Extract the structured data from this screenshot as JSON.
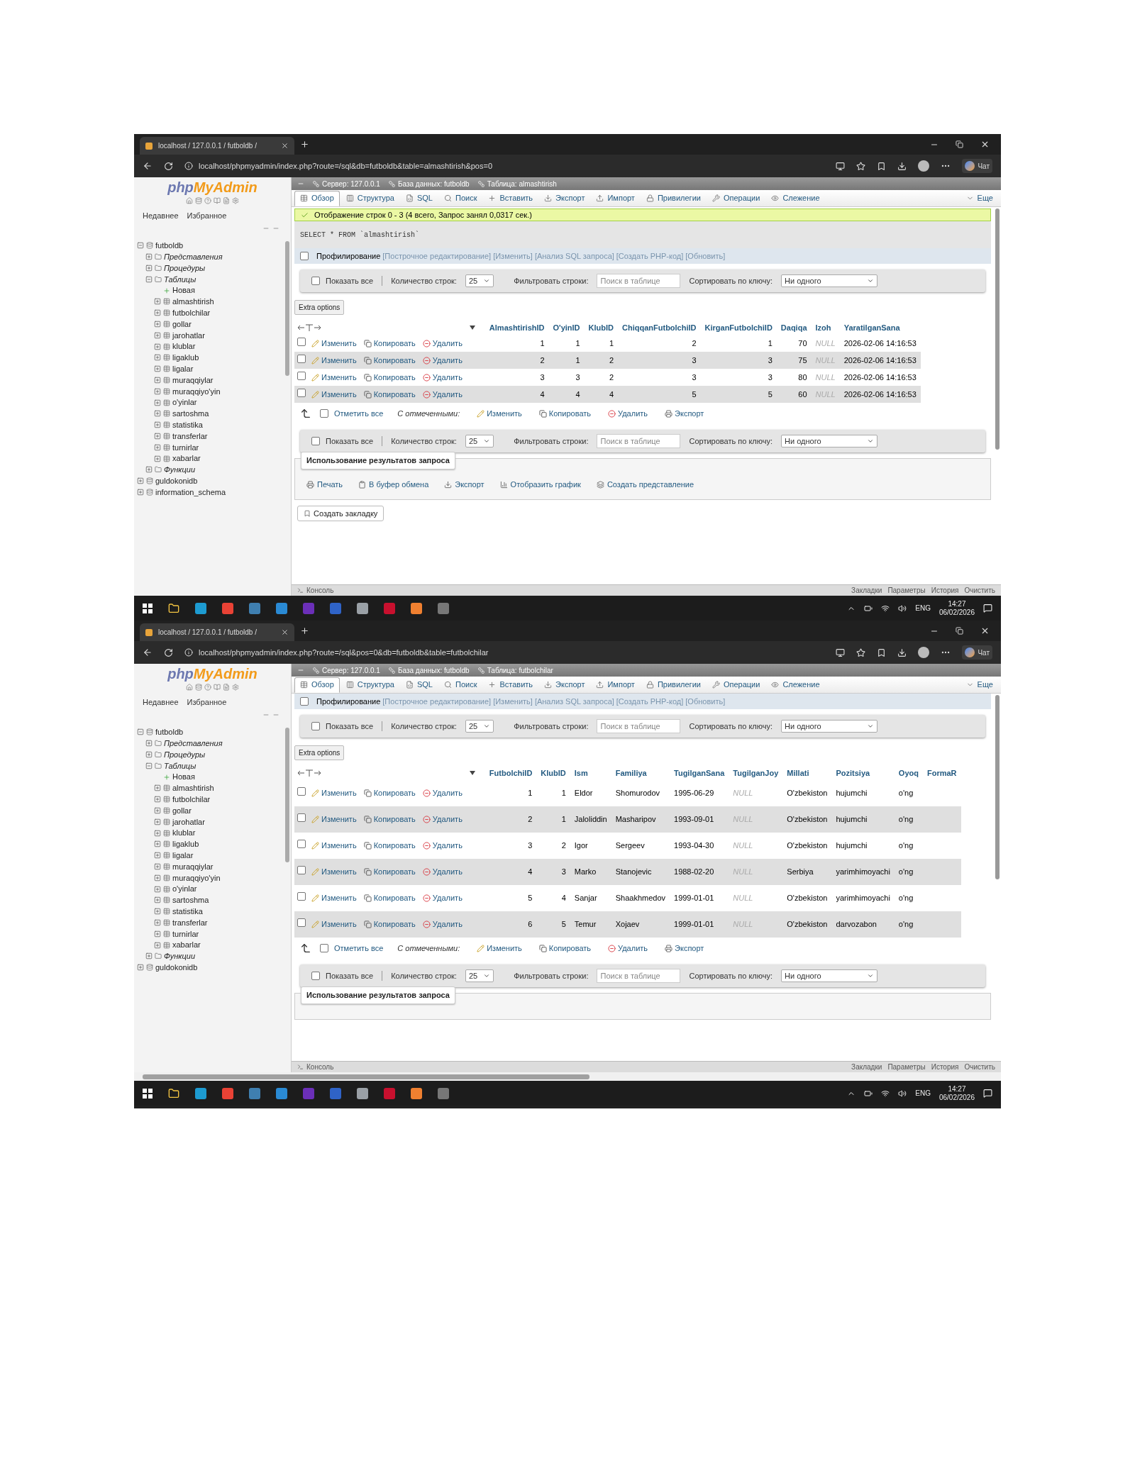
{
  "screens": [
    {
      "browser_tab": "localhost / 127.0.0.1 / futboldb /",
      "url": "localhost/phpmyadmin/index.php?route=/sql&db=futboldb&table=almashtirish&pos=0",
      "chat_button": "Чат",
      "logo": {
        "php": "php",
        "myadmin": "MyAdmin"
      },
      "sidebar_tabs": [
        "Недавнее",
        "Избранное"
      ],
      "tree": [
        {
          "label": "futboldb",
          "kind": "db",
          "expanded": true,
          "children": [
            {
              "label": "Представления",
              "kind": "group",
              "expanded": false
            },
            {
              "label": "Процедуры",
              "kind": "group",
              "expanded": false
            },
            {
              "label": "Таблицы",
              "kind": "group",
              "expanded": true,
              "children": [
                {
                  "label": "Новая",
                  "kind": "new"
                },
                {
                  "label": "almashtirish",
                  "kind": "table",
                  "expanded": false
                },
                {
                  "label": "futbolchilar",
                  "kind": "table",
                  "expanded": false
                },
                {
                  "label": "gollar",
                  "kind": "table",
                  "expanded": false
                },
                {
                  "label": "jarohatlar",
                  "kind": "table",
                  "expanded": false
                },
                {
                  "label": "klublar",
                  "kind": "table",
                  "expanded": false
                },
                {
                  "label": "ligaklub",
                  "kind": "table",
                  "expanded": false
                },
                {
                  "label": "ligalar",
                  "kind": "table",
                  "expanded": false
                },
                {
                  "label": "muraqqiylar",
                  "kind": "table",
                  "expanded": false
                },
                {
                  "label": "muraqqiyo'yin",
                  "kind": "table",
                  "expanded": false
                },
                {
                  "label": "o'yinlar",
                  "kind": "table",
                  "expanded": false
                },
                {
                  "label": "sartoshma",
                  "kind": "table",
                  "expanded": false
                },
                {
                  "label": "statistika",
                  "kind": "table",
                  "expanded": false
                },
                {
                  "label": "transferlar",
                  "kind": "table",
                  "expanded": false
                },
                {
                  "label": "turnirlar",
                  "kind": "table",
                  "expanded": false
                },
                {
                  "label": "xabarlar",
                  "kind": "table",
                  "expanded": false
                }
              ]
            },
            {
              "label": "Функции",
              "kind": "group",
              "expanded": false
            }
          ]
        },
        {
          "label": "guldokonidb",
          "kind": "db",
          "expanded": false
        },
        {
          "label": "information_schema",
          "kind": "db",
          "expanded": false
        }
      ],
      "breadcrumb": [
        "Сервер: 127.0.0.1",
        "База данных: futboldb",
        "Таблица: almashtirish"
      ],
      "menu_tabs": [
        {
          "label": "Обзор",
          "selected": true
        },
        {
          "label": "Структура",
          "selected": false
        },
        {
          "label": "SQL",
          "selected": false
        },
        {
          "label": "Поиск",
          "selected": false
        },
        {
          "label": "Вставить",
          "selected": false
        },
        {
          "label": "Экспорт",
          "selected": false
        },
        {
          "label": "Импорт",
          "selected": false
        },
        {
          "label": "Привилегии",
          "selected": false
        },
        {
          "label": "Операции",
          "selected": false
        },
        {
          "label": "Слежение",
          "selected": false
        },
        {
          "label": "Еще",
          "selected": false
        }
      ],
      "message": "Отображение строк 0 - 3 (4 всего, Запрос занял 0,0317 сек.)",
      "sql": "SELECT * FROM `almashtirish`",
      "profiling": {
        "label": "Профилирование",
        "checked": false,
        "links": [
          "[Построчное редактирование]",
          "[Изменить]",
          "[Анализ SQL запроса]",
          "[Создать PHP-код]",
          "[Обновить]"
        ]
      },
      "top_filter": {
        "show_all": "Показать все",
        "checked": false,
        "rows_label": "Количество строк:",
        "rows_value": "25",
        "filter_label": "Фильтровать строки:",
        "filter_placeholder": "Поиск в таблице",
        "sort_label": "Сортировать по ключу:",
        "sort_value": "Ни одного"
      },
      "extra_options": "Extra options",
      "table": {
        "columns": [
          {
            "label": "AlmashtirishID",
            "kind": "number"
          },
          {
            "label": "O'yinID",
            "kind": "number"
          },
          {
            "label": "KlubID",
            "kind": "number"
          },
          {
            "label": "ChiqqanFutbolchiID",
            "kind": "number"
          },
          {
            "label": "KirganFutbolchiID",
            "kind": "number"
          },
          {
            "label": "Daqiqa",
            "kind": "number"
          },
          {
            "label": "Izoh",
            "kind": "null"
          },
          {
            "label": "YaratilganSana",
            "kind": "text"
          }
        ],
        "rows": [
          {
            "checked": false,
            "actions": [
              "Изменить",
              "Копировать",
              "Удалить"
            ],
            "cells": [
              "1",
              "1",
              "1",
              "2",
              "1",
              "70",
              "NULL",
              "2026-02-06 14:16:53"
            ]
          },
          {
            "checked": false,
            "actions": [
              "Изменить",
              "Копировать",
              "Удалить"
            ],
            "cells": [
              "2",
              "1",
              "2",
              "3",
              "3",
              "75",
              "NULL",
              "2026-02-06 14:16:53"
            ]
          },
          {
            "checked": false,
            "actions": [
              "Изменить",
              "Копировать",
              "Удалить"
            ],
            "cells": [
              "3",
              "3",
              "2",
              "3",
              "3",
              "80",
              "NULL",
              "2026-02-06 14:16:53"
            ]
          },
          {
            "checked": false,
            "actions": [
              "Изменить",
              "Копировать",
              "Удалить"
            ],
            "cells": [
              "4",
              "4",
              "4",
              "5",
              "5",
              "60",
              "NULL",
              "2026-02-06 14:16:53"
            ]
          }
        ]
      },
      "bulk": {
        "check_all": "Отметить все",
        "checked": false,
        "with_selected": "С отмеченными:",
        "actions": [
          "Изменить",
          "Копировать",
          "Удалить",
          "Экспорт"
        ]
      },
      "bottom_filter": {
        "show_all": "Показать все",
        "checked": false,
        "rows_label": "Количество строк:",
        "rows_value": "25",
        "filter_label": "Фильтровать строки:",
        "filter_placeholder": "Поиск в таблице",
        "sort_label": "Сортировать по ключу:",
        "sort_value": "Ни одного"
      },
      "query_results": {
        "title": "Использование результатов запроса",
        "actions": [
          "Печать",
          "В буфер обмена",
          "Экспорт",
          "Отобразить график",
          "Создать представление"
        ]
      },
      "bookmark_button": "Создать закладку",
      "console": {
        "label": "Консоль",
        "links": [
          "Закладки",
          "Параметры",
          "История",
          "Очистить"
        ]
      },
      "taskbar": {
        "language": "ENG",
        "time": "14:27",
        "date": "06/02/2026"
      }
    },
    {
      "browser_tab": "localhost / 127.0.0.1 / futboldb /",
      "url": "localhost/phpmyadmin/index.php?route=/sql&pos=0&db=futboldb&table=futbolchilar",
      "chat_button": "Чат",
      "logo": {
        "php": "php",
        "myadmin": "MyAdmin"
      },
      "sidebar_tabs": [
        "Недавнее",
        "Избранное"
      ],
      "tree": [
        {
          "label": "futboldb",
          "kind": "db",
          "expanded": true,
          "children": [
            {
              "label": "Представления",
              "kind": "group",
              "expanded": false
            },
            {
              "label": "Процедуры",
              "kind": "group",
              "expanded": false
            },
            {
              "label": "Таблицы",
              "kind": "group",
              "expanded": true,
              "children": [
                {
                  "label": "Новая",
                  "kind": "new"
                },
                {
                  "label": "almashtirish",
                  "kind": "table",
                  "expanded": false
                },
                {
                  "label": "futbolchilar",
                  "kind": "table",
                  "expanded": false
                },
                {
                  "label": "gollar",
                  "kind": "table",
                  "expanded": false
                },
                {
                  "label": "jarohatlar",
                  "kind": "table",
                  "expanded": false
                },
                {
                  "label": "klublar",
                  "kind": "table",
                  "expanded": false
                },
                {
                  "label": "ligaklub",
                  "kind": "table",
                  "expanded": false
                },
                {
                  "label": "ligalar",
                  "kind": "table",
                  "expanded": false
                },
                {
                  "label": "muraqqiylar",
                  "kind": "table",
                  "expanded": false
                },
                {
                  "label": "muraqqiyo'yin",
                  "kind": "table",
                  "expanded": false
                },
                {
                  "label": "o'yinlar",
                  "kind": "table",
                  "expanded": false
                },
                {
                  "label": "sartoshma",
                  "kind": "table",
                  "expanded": false
                },
                {
                  "label": "statistika",
                  "kind": "table",
                  "expanded": false
                },
                {
                  "label": "transferlar",
                  "kind": "table",
                  "expanded": false
                },
                {
                  "label": "turnirlar",
                  "kind": "table",
                  "expanded": false
                },
                {
                  "label": "xabarlar",
                  "kind": "table",
                  "expanded": false
                }
              ]
            },
            {
              "label": "Функции",
              "kind": "group",
              "expanded": false
            }
          ]
        },
        {
          "label": "guldokonidb",
          "kind": "db",
          "expanded": false
        }
      ],
      "breadcrumb": [
        "Сервер: 127.0.0.1",
        "База данных: futboldb",
        "Таблица: futbolchilar"
      ],
      "menu_tabs": [
        {
          "label": "Обзор",
          "selected": true
        },
        {
          "label": "Структура",
          "selected": false
        },
        {
          "label": "SQL",
          "selected": false
        },
        {
          "label": "Поиск",
          "selected": false
        },
        {
          "label": "Вставить",
          "selected": false
        },
        {
          "label": "Экспорт",
          "selected": false
        },
        {
          "label": "Импорт",
          "selected": false
        },
        {
          "label": "Привилегии",
          "selected": false
        },
        {
          "label": "Операции",
          "selected": false
        },
        {
          "label": "Слежение",
          "selected": false
        },
        {
          "label": "Еще",
          "selected": false
        }
      ],
      "profiling": {
        "label": "Профилирование",
        "checked": false,
        "links": [
          "[Построчное редактирование]",
          "[Изменить]",
          "[Анализ SQL запроса]",
          "[Создать PHP-код]",
          "[Обновить]"
        ]
      },
      "top_filter": {
        "show_all": "Показать все",
        "checked": false,
        "rows_label": "Количество строк:",
        "rows_value": "25",
        "filter_label": "Фильтровать строки:",
        "filter_placeholder": "Поиск в таблице",
        "sort_label": "Сортировать по ключу:",
        "sort_value": "Ни одного"
      },
      "extra_options": "Extra options",
      "table": {
        "columns": [
          {
            "label": "FutbolchiID",
            "kind": "number"
          },
          {
            "label": "KlubID",
            "kind": "number"
          },
          {
            "label": "Ism",
            "kind": "text"
          },
          {
            "label": "Familiya",
            "kind": "text"
          },
          {
            "label": "TugilganSana",
            "kind": "text"
          },
          {
            "label": "TugilganJoy",
            "kind": "null"
          },
          {
            "label": "Millati",
            "kind": "text"
          },
          {
            "label": "Pozitsiya",
            "kind": "text"
          },
          {
            "label": "Oyoq",
            "kind": "text"
          },
          {
            "label": "FormaR",
            "kind": "text"
          }
        ],
        "rows": [
          {
            "checked": false,
            "actions": [
              "Изменить",
              "Копировать",
              "Удалить"
            ],
            "cells": [
              "1",
              "1",
              "Eldor",
              "Shomurodov",
              "1995-06-29",
              "NULL",
              "O'zbekiston",
              "hujumchi",
              "o'ng"
            ]
          },
          {
            "checked": false,
            "actions": [
              "Изменить",
              "Копировать",
              "Удалить"
            ],
            "cells": [
              "2",
              "1",
              "Jaloliddin",
              "Masharipov",
              "1993-09-01",
              "NULL",
              "O'zbekiston",
              "hujumchi",
              "o'ng"
            ]
          },
          {
            "checked": false,
            "actions": [
              "Изменить",
              "Копировать",
              "Удалить"
            ],
            "cells": [
              "3",
              "2",
              "Igor",
              "Sergeev",
              "1993-04-30",
              "NULL",
              "O'zbekiston",
              "hujumchi",
              "o'ng"
            ]
          },
          {
            "checked": false,
            "actions": [
              "Изменить",
              "Копировать",
              "Удалить"
            ],
            "cells": [
              "4",
              "3",
              "Marko",
              "Stanojevic",
              "1988-02-20",
              "NULL",
              "Serbiya",
              "yarimhimoyachi",
              "o'ng"
            ]
          },
          {
            "checked": false,
            "actions": [
              "Изменить",
              "Копировать",
              "Удалить"
            ],
            "cells": [
              "5",
              "4",
              "Sanjar",
              "Shaakhmedov",
              "1999-01-01",
              "NULL",
              "O'zbekiston",
              "yarimhimoyachi",
              "o'ng"
            ]
          },
          {
            "checked": false,
            "actions": [
              "Изменить",
              "Копировать",
              "Удалить"
            ],
            "cells": [
              "6",
              "5",
              "Temur",
              "Xojaev",
              "1999-01-01",
              "NULL",
              "O'zbekiston",
              "darvozabon",
              "o'ng"
            ]
          }
        ]
      },
      "bulk": {
        "check_all": "Отметить все",
        "checked": false,
        "with_selected": "С отмеченными:",
        "actions": [
          "Изменить",
          "Копировать",
          "Удалить",
          "Экспорт"
        ]
      },
      "bottom_filter": {
        "show_all": "Показать все",
        "checked": false,
        "rows_label": "Количество строк:",
        "rows_value": "25",
        "filter_label": "Фильтровать строки:",
        "filter_placeholder": "Поиск в таблице",
        "sort_label": "Сортировать по ключу:",
        "sort_value": "Ни одного"
      },
      "query_results": {
        "title": "Использование результатов запроса"
      },
      "console": {
        "label": "Консоль",
        "links": [
          "Закладки",
          "Параметры",
          "История",
          "Очистить"
        ]
      },
      "taskbar": {
        "language": "ENG",
        "time": "14:27",
        "date": "06/02/2026"
      }
    }
  ]
}
